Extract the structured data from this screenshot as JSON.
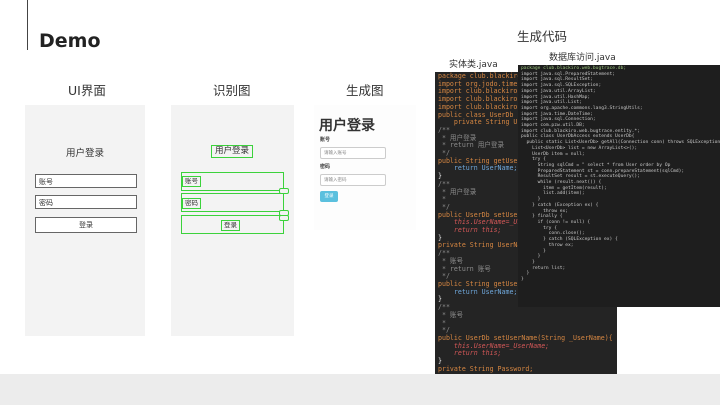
{
  "title": "Demo",
  "panels": {
    "ui_label": "UI界面",
    "recognize_label": "识别图",
    "generated_label": "生成图",
    "ui": {
      "heading": "用户登录",
      "account": "账号",
      "password": "密码",
      "login": "登录"
    },
    "recognized": {
      "heading": "用户登录",
      "account": "账号",
      "password": "密码",
      "login": "登录"
    },
    "generated": {
      "heading": "用户登录",
      "account_label": "账号",
      "account_placeholder": "请输入账号",
      "password_label": "密码",
      "password_placeholder": "请输入密码",
      "login": "登录"
    }
  },
  "code": {
    "section_label": "生成代码",
    "entity_file": "实体类.java",
    "dao_file": "数据库访问.java",
    "entity_lines": [
      {
        "c": "k",
        "text": "package club.blackiro"
      },
      {
        "c": "k",
        "text": "import org.jodo.time."
      },
      {
        "c": "k",
        "text": "import club.blackiro"
      },
      {
        "c": "k",
        "text": "import club.blackiro"
      },
      {
        "c": "k",
        "text": "import club.blackiro"
      },
      {
        "c": "k",
        "text": "public class UserDb {"
      },
      {
        "c": "k",
        "text": "    private String Us"
      },
      {
        "c": "c",
        "text": "/**"
      },
      {
        "c": "c",
        "text": " * 用户登录"
      },
      {
        "c": "c",
        "text": " * return 用户登录"
      },
      {
        "c": "c",
        "text": " */"
      },
      {
        "c": "k",
        "text": "public String getUser"
      },
      {
        "c": "s",
        "text": "    return UserName;"
      },
      {
        "c": "t",
        "text": "}"
      },
      {
        "c": "c",
        "text": "/**"
      },
      {
        "c": "c",
        "text": " * 用户登录"
      },
      {
        "c": "c",
        "text": " *"
      },
      {
        "c": "c",
        "text": " */"
      },
      {
        "c": "k",
        "text": "public UserDb setUser"
      },
      {
        "c": "i",
        "text": "    this.UserName=_Us"
      },
      {
        "c": "i",
        "text": "    return this;"
      },
      {
        "c": "t",
        "text": "}"
      },
      {
        "c": "k",
        "text": "private String UserNam"
      },
      {
        "c": "c",
        "text": "/**"
      },
      {
        "c": "c",
        "text": " * 账号"
      },
      {
        "c": "c",
        "text": " * return 账号"
      },
      {
        "c": "c",
        "text": " */"
      },
      {
        "c": "k",
        "text": "public String getUser"
      },
      {
        "c": "s",
        "text": "    return UserName;"
      },
      {
        "c": "t",
        "text": "}"
      },
      {
        "c": "c",
        "text": "/**"
      },
      {
        "c": "c",
        "text": " * 账号"
      },
      {
        "c": "c",
        "text": " *"
      },
      {
        "c": "c",
        "text": " */"
      },
      {
        "c": "k",
        "text": "public UserDb setUserName(String _UserName){"
      },
      {
        "c": "i",
        "text": "    this.UserName=_UserName;"
      },
      {
        "c": "i",
        "text": "    return this;"
      },
      {
        "c": "t",
        "text": "}"
      },
      {
        "c": "k",
        "text": "private String Password;"
      }
    ],
    "dao_lines": [
      {
        "c": "f",
        "text": "package club.blackiro.web.bugtrace.db;"
      },
      {
        "c": "u",
        "text": "import java.sql.PreparedStatement;"
      },
      {
        "c": "u",
        "text": "import java.sql.ResultSet;"
      },
      {
        "c": "u",
        "text": "import java.sql.SQLException;"
      },
      {
        "c": "u",
        "text": "import java.util.ArrayList;"
      },
      {
        "c": "u",
        "text": "import java.util.HashMap;"
      },
      {
        "c": "u",
        "text": "import java.util.List;"
      },
      {
        "c": "u",
        "text": "import org.apache.commons.lang3.StringUtils;"
      },
      {
        "c": "u",
        "text": "import java.time.DateTime;"
      },
      {
        "c": "u",
        "text": "import java.sql.Connection;"
      },
      {
        "c": "u",
        "text": "import com.pzw.util.DB;"
      },
      {
        "c": "u",
        "text": "import club.blackiro.web.bugtrace.entity.*;"
      },
      {
        "c": "u",
        "text": "public class UserDbAccess extends UserDb{"
      },
      {
        "c": "u",
        "text": "  public static List<UserDb> getAll(Connection conn) throws SQLException{"
      },
      {
        "c": "u",
        "text": "    List<UserDb> list = new ArrayList<>();"
      },
      {
        "c": "u",
        "text": "    UserDb item = null;"
      },
      {
        "c": "u",
        "text": "    try {"
      },
      {
        "c": "u",
        "text": "      String sqlCmd = \" select * from User order by Op"
      },
      {
        "c": "u",
        "text": "      PreparedStatement st = conn.prepareStatement(sqlCmd);"
      },
      {
        "c": "u",
        "text": "      ResultSet result = st.executeQuery();"
      },
      {
        "c": "u",
        "text": "      while (result.next()) {"
      },
      {
        "c": "u",
        "text": "        item = getItem(result);"
      },
      {
        "c": "u",
        "text": "        list.add(item);"
      },
      {
        "c": "u",
        "text": "      }"
      },
      {
        "c": "u",
        "text": "    } catch (Exception ex) {"
      },
      {
        "c": "u",
        "text": "        throw ex;"
      },
      {
        "c": "u",
        "text": "    } finally {"
      },
      {
        "c": "u",
        "text": "      if (conn != null) {"
      },
      {
        "c": "u",
        "text": "        try {"
      },
      {
        "c": "u",
        "text": "          conn.close();"
      },
      {
        "c": "u",
        "text": "        } catch (SQLException ex) {"
      },
      {
        "c": "u",
        "text": "          throw ex;"
      },
      {
        "c": "u",
        "text": "        }"
      },
      {
        "c": "u",
        "text": "      }"
      },
      {
        "c": "u",
        "text": "    }"
      },
      {
        "c": "u",
        "text": "    return list;"
      },
      {
        "c": "u",
        "text": "  }"
      },
      {
        "c": "u",
        "text": "}"
      }
    ]
  },
  "colors": {
    "recognition_box": "#3bd23b",
    "login_button": "#5bc0de",
    "code_background": "#242424"
  }
}
